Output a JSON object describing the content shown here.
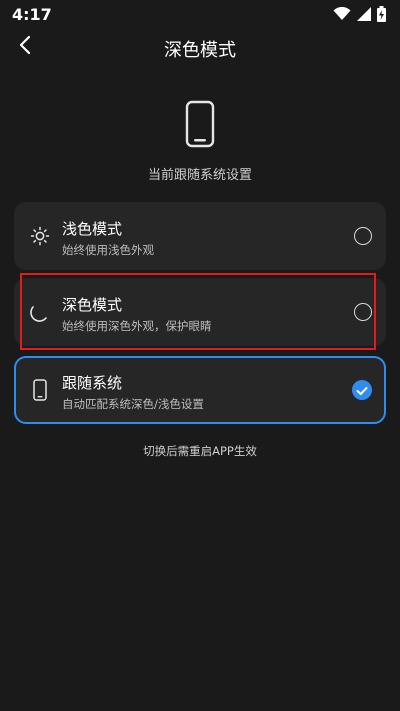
{
  "status_bar": {
    "time": "4:17",
    "icons": [
      "wifi-icon",
      "signal-icon",
      "battery-charging-icon"
    ]
  },
  "header": {
    "back_icon": "chevron-left-icon",
    "title": "深色模式"
  },
  "hero": {
    "icon": "phone-icon",
    "text": "当前跟随系统设置"
  },
  "options": [
    {
      "title": "浅色模式",
      "subtitle": "始终使用浅色外观",
      "icon": "sun-icon",
      "selected": false
    },
    {
      "title": "深色模式",
      "subtitle": "始终使用深色外观，保护眼睛",
      "icon": "moon-icon",
      "selected": false
    },
    {
      "title": "跟随系统",
      "subtitle": "自动匹配系统深色/浅色设置",
      "icon": "phone-icon",
      "selected": true
    }
  ],
  "footer_note": "切换后需重启APP生效",
  "colors": {
    "background": "#1a1a1a",
    "card": "#262626",
    "accent": "#2f8cf0",
    "highlight": "#e21b1b"
  }
}
